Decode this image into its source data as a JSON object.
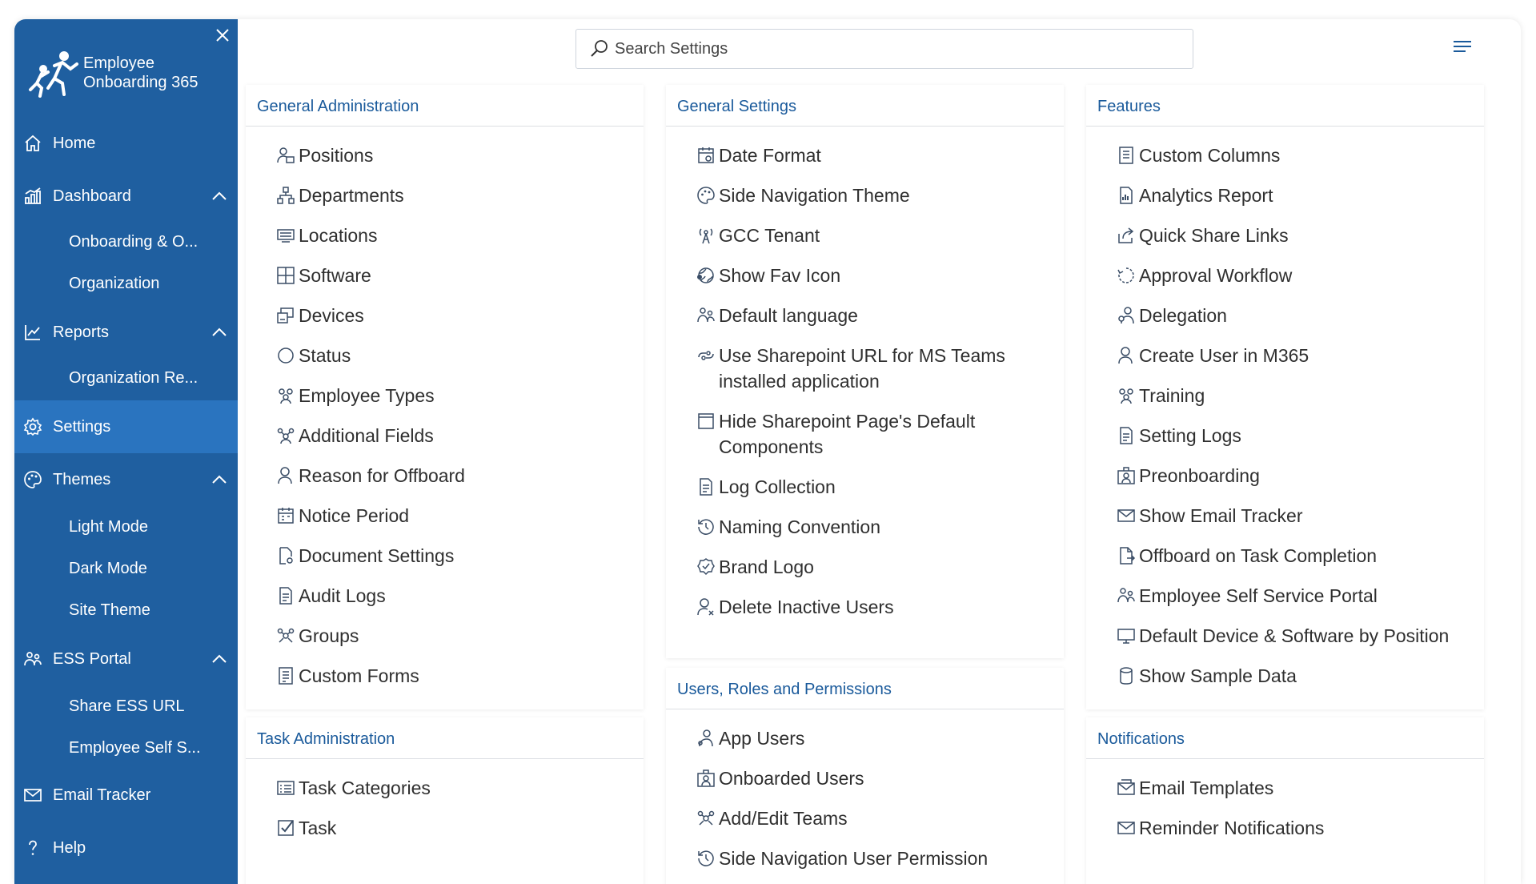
{
  "colors": {
    "sidebar": "#1f5fa0",
    "sidebar_active": "#2a74bf",
    "section_title": "#1a5a9b",
    "item_text": "#2f2f2f",
    "icon": "#3a4d66"
  },
  "sidebar": {
    "brand": {
      "line1": "Employee",
      "line2": "Onboarding 365"
    },
    "close_icon": "close-icon",
    "items": [
      {
        "label": "Home",
        "icon": "home-icon"
      },
      {
        "label": "Dashboard",
        "icon": "dashboard-icon"
      },
      {
        "label": "Onboarding & O..."
      },
      {
        "label": "Organization"
      },
      {
        "label": "Reports",
        "icon": "chart-line-icon"
      },
      {
        "label": "Organization Re..."
      },
      {
        "label": "Settings",
        "icon": "gear-icon"
      },
      {
        "label": "Themes",
        "icon": "palette-icon"
      },
      {
        "label": "Light Mode"
      },
      {
        "label": "Dark Mode"
      },
      {
        "label": "Site Theme"
      },
      {
        "label": "ESS Portal",
        "icon": "people-icon"
      },
      {
        "label": "Share ESS URL"
      },
      {
        "label": "Employee Self S..."
      },
      {
        "label": "Email Tracker",
        "icon": "mail-icon"
      },
      {
        "label": "Help",
        "icon": "help-icon"
      }
    ]
  },
  "search": {
    "placeholder": "Search Settings"
  },
  "sections": {
    "general_admin": {
      "title": "General Administration",
      "items": [
        "Positions",
        "Departments",
        "Locations",
        "Software",
        "Devices",
        "Status",
        "Employee Types",
        "Additional Fields",
        "Reason for Offboard",
        "Notice Period",
        "Document Settings",
        "Audit Logs",
        "Groups",
        "Custom Forms"
      ]
    },
    "task_admin": {
      "title": "Task Administration",
      "items": [
        "Task Categories",
        "Task"
      ]
    },
    "general_settings": {
      "title": "General Settings",
      "items": [
        "Date Format",
        "Side Navigation Theme",
        "GCC Tenant",
        "Show Fav Icon",
        "Default language",
        "Use Sharepoint URL for MS Teams installed application",
        "Hide Sharepoint Page's Default Components",
        "Log Collection",
        "Naming Convention",
        "Brand Logo",
        "Delete Inactive Users"
      ]
    },
    "users_roles": {
      "title": "Users, Roles and Permissions",
      "items": [
        "App Users",
        "Onboarded Users",
        "Add/Edit Teams",
        "Side Navigation User Permission"
      ]
    },
    "features": {
      "title": "Features",
      "items": [
        "Custom Columns",
        "Analytics Report",
        "Quick Share Links",
        "Approval Workflow",
        "Delegation",
        "Create User in M365",
        "Training",
        "Setting Logs",
        "Preonboarding",
        "Show Email Tracker",
        "Offboard on Task Completion",
        "Employee Self Service Portal",
        "Default Device & Software by Position",
        "Show Sample Data"
      ]
    },
    "notifications": {
      "title": "Notifications",
      "items": [
        "Email Templates",
        "Reminder Notifications"
      ]
    }
  }
}
